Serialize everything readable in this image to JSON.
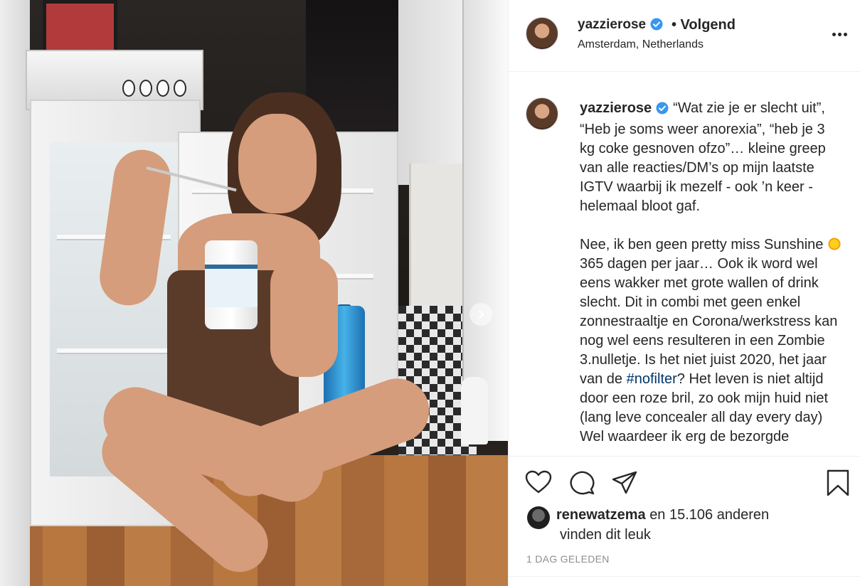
{
  "post": {
    "username": "yazzierose",
    "follow_label": "• Volgend",
    "location": "Amsterdam, Netherlands",
    "caption_p1": "“Wat zie je er slecht uit”, “Heb je soms weer anorexia”, “heb je 3 kg coke gesnoven ofzo”… kleine greep van alle reacties/DM’s op mijn laatste IGTV waarbij ik mezelf - ook ’n keer - helemaal bloot gaf.",
    "caption_p2a": "Nee, ik ben geen pretty miss Sunshine",
    "caption_p2b": "365 dagen per jaar… Ook ik word wel eens wakker met grote wallen of drink slecht. Dit in combi met geen enkel zonnestraaltje en Corona/werkstress kan nog wel eens resulteren in een Zombie 3.nulletje. Is het niet juist 2020, het jaar van de",
    "hashtag": "#nofilter",
    "caption_p2c": "? Het leven is niet altijd door een roze bril, zo ook mijn huid niet (lang leve concealer all day every day)",
    "caption_p3": "Wel waardeer ik erg de bezorgde",
    "liked_by_user": "renewatzema",
    "liked_by_rest": "en 15.106 anderen",
    "liked_line2": "vinden dit leuk",
    "timestamp": "1 DAG GELEDEN"
  },
  "icons": {
    "verified": "verified-badge-icon",
    "more": "more-options-icon",
    "like": "heart-icon",
    "comment": "comment-icon",
    "share": "paper-plane-icon",
    "save": "bookmark-icon",
    "next": "chevron-right-icon",
    "sun": "sun-emoji-icon"
  },
  "colors": {
    "verified_blue": "#3897f0",
    "hashtag": "#00376b",
    "muted": "#8e8e8e",
    "text": "#262626"
  }
}
